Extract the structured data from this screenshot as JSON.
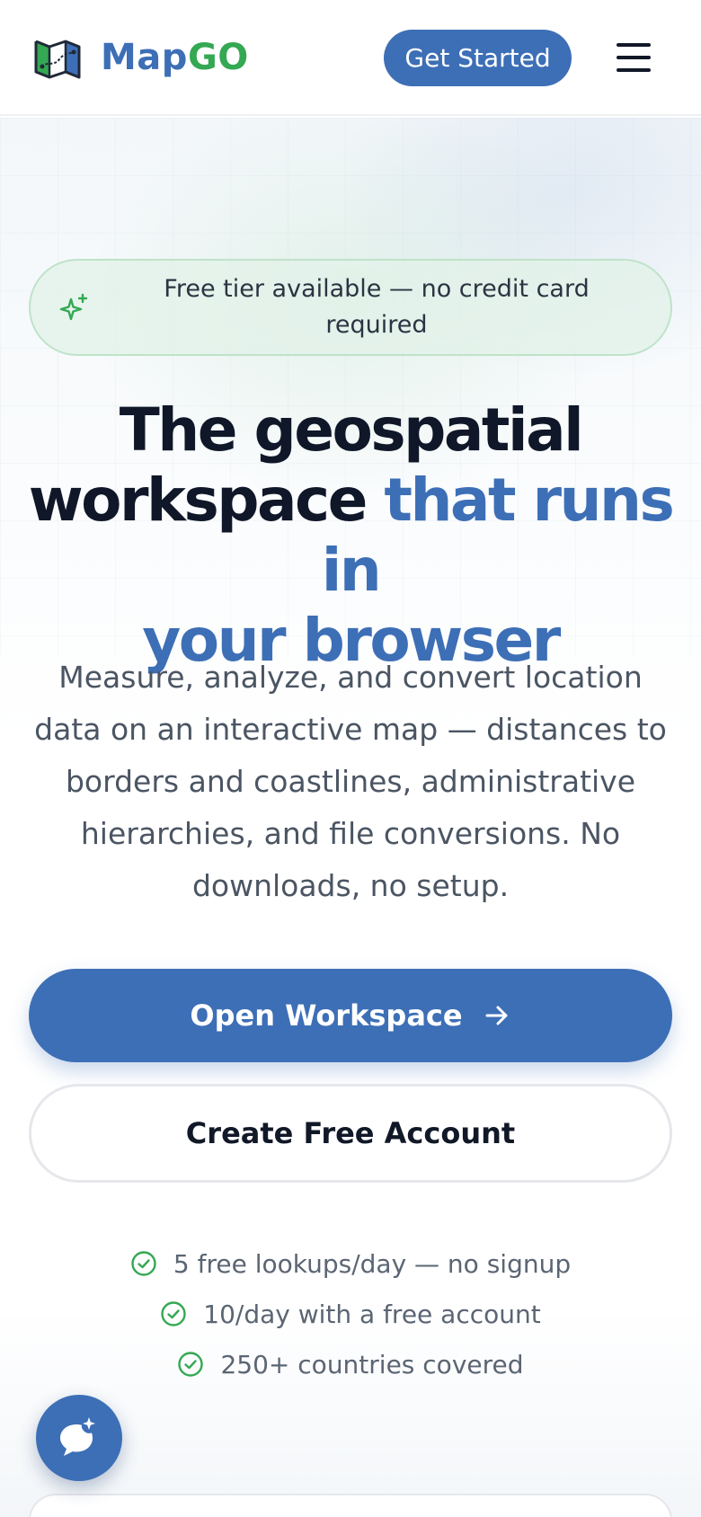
{
  "header": {
    "logo_part1": "Map",
    "logo_part2": "GO",
    "get_started_label": "Get Started",
    "menu_icon": "hamburger-menu-icon"
  },
  "hero": {
    "badge_icon": "sparkle-icon",
    "badge_text": "Free tier available — no credit card required",
    "headline_line1": "The geospatial",
    "headline_line2_start": "workspace",
    "headline_line2_accent": "that runs in",
    "headline_line3_accent": "your browser",
    "subtext": "Measure, analyze, and convert location data on an interactive map — distances to borders and coastlines, administrative hierarchies, and file conversions. No downloads, no setup.",
    "primary_cta": "Open Workspace",
    "secondary_cta": "Create Free Account",
    "features": [
      "5 free lookups/day — no signup",
      "10/day with a free account",
      "250+ countries covered"
    ]
  },
  "colors": {
    "brand_blue": "#3d6fb6",
    "brand_green": "#34a853",
    "text_dark": "#0f1729"
  }
}
